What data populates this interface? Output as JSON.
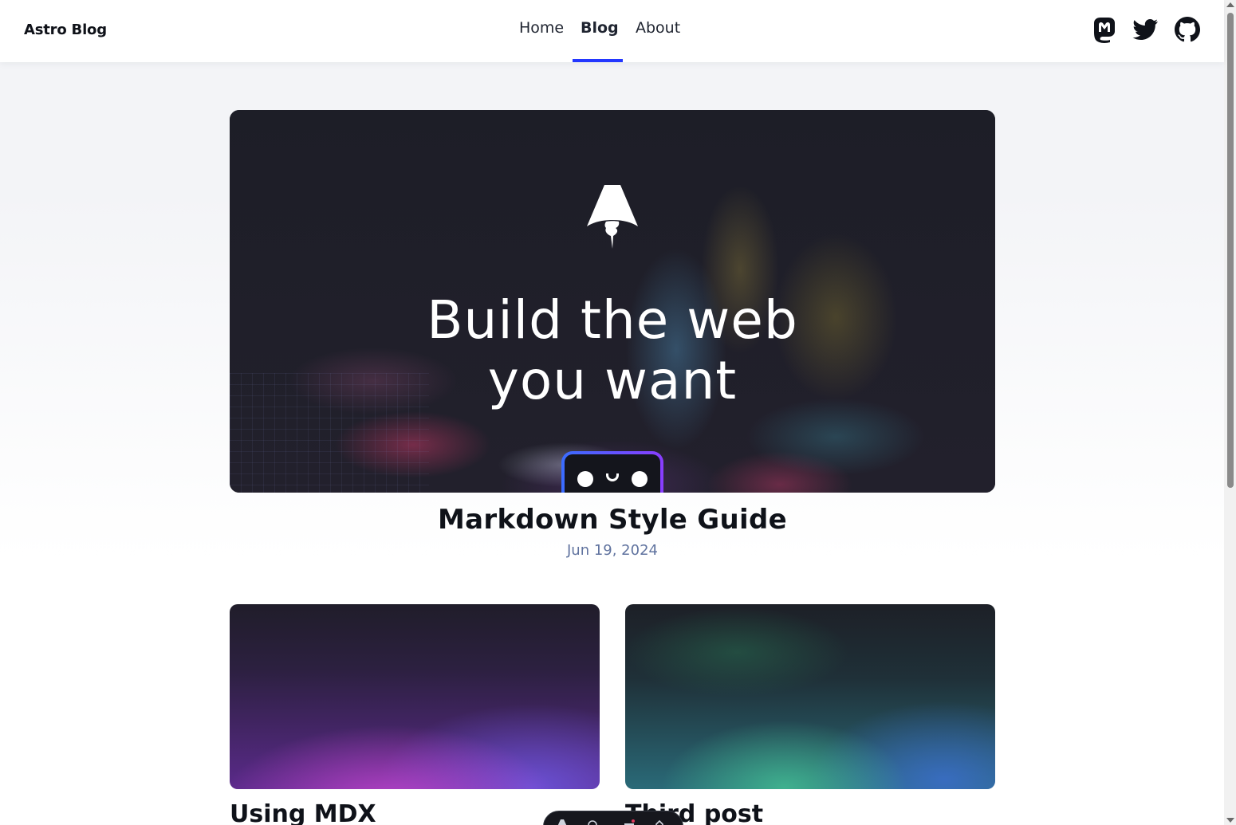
{
  "header": {
    "brand": "Astro Blog",
    "nav": [
      {
        "label": "Home",
        "active": false
      },
      {
        "label": "Blog",
        "active": true
      },
      {
        "label": "About",
        "active": false
      }
    ],
    "social": [
      {
        "icon": "mastodon-icon"
      },
      {
        "icon": "twitter-icon"
      },
      {
        "icon": "github-icon"
      }
    ],
    "accent_color": "#2337ff"
  },
  "featured_post": {
    "image": {
      "headline_line1": "Build the web",
      "headline_line2": "you want"
    },
    "title": "Markdown Style Guide",
    "date": "Jun 19, 2024"
  },
  "posts": [
    {
      "title": "Using MDX"
    },
    {
      "title": "Third post"
    }
  ]
}
